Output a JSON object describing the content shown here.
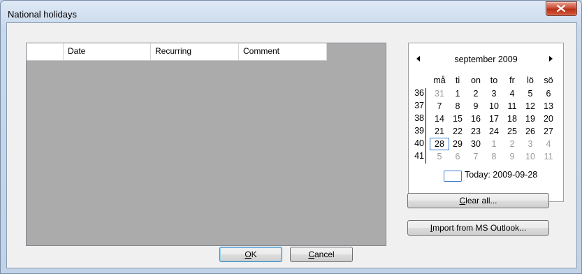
{
  "window": {
    "title": "National holidays"
  },
  "grid": {
    "columns": [
      "",
      "Date",
      "Recurring",
      "Comment"
    ],
    "rows": []
  },
  "calendar": {
    "month_label": "september 2009",
    "weekdays": [
      "må",
      "ti",
      "on",
      "to",
      "fr",
      "lö",
      "sö"
    ],
    "weeks": [
      {
        "num": "36",
        "days": [
          [
            "31",
            1
          ],
          [
            "1",
            0
          ],
          [
            "2",
            0
          ],
          [
            "3",
            0
          ],
          [
            "4",
            0
          ],
          [
            "5",
            0
          ],
          [
            "6",
            0
          ]
        ]
      },
      {
        "num": "37",
        "days": [
          [
            "7",
            0
          ],
          [
            "8",
            0
          ],
          [
            "9",
            0
          ],
          [
            "10",
            0
          ],
          [
            "11",
            0
          ],
          [
            "12",
            0
          ],
          [
            "13",
            0
          ]
        ]
      },
      {
        "num": "38",
        "days": [
          [
            "14",
            0
          ],
          [
            "15",
            0
          ],
          [
            "16",
            0
          ],
          [
            "17",
            0
          ],
          [
            "18",
            0
          ],
          [
            "19",
            0
          ],
          [
            "20",
            0
          ]
        ]
      },
      {
        "num": "39",
        "days": [
          [
            "21",
            0
          ],
          [
            "22",
            0
          ],
          [
            "23",
            0
          ],
          [
            "24",
            0
          ],
          [
            "25",
            0
          ],
          [
            "26",
            0
          ],
          [
            "27",
            0
          ]
        ]
      },
      {
        "num": "40",
        "days": [
          [
            "28",
            2
          ],
          [
            "29",
            0
          ],
          [
            "30",
            0
          ],
          [
            "1",
            1
          ],
          [
            "2",
            1
          ],
          [
            "3",
            1
          ],
          [
            "4",
            1
          ]
        ]
      },
      {
        "num": "41",
        "days": [
          [
            "5",
            1
          ],
          [
            "6",
            1
          ],
          [
            "7",
            1
          ],
          [
            "8",
            1
          ],
          [
            "9",
            1
          ],
          [
            "10",
            1
          ],
          [
            "11",
            1
          ]
        ]
      }
    ],
    "today_label": "Today: 2009-09-28",
    "today_color": "#3a7bd5"
  },
  "buttons": {
    "clear_all": {
      "mnemonic": "C",
      "rest": "lear all..."
    },
    "import": {
      "mnemonic": "I",
      "rest": "mport from MS Outlook..."
    },
    "ok": {
      "mnemonic": "O",
      "rest": "K"
    },
    "cancel": {
      "mnemonic": "C",
      "rest": "ancel"
    }
  }
}
